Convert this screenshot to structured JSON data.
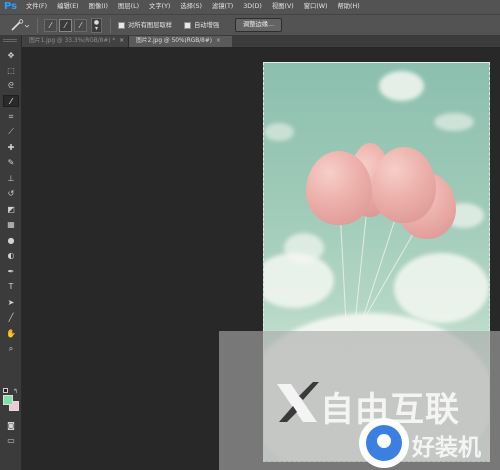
{
  "app": {
    "logo": "Ps"
  },
  "menu": [
    "文件(F)",
    "编辑(E)",
    "图像(I)",
    "图层(L)",
    "文字(Y)",
    "选择(S)",
    "滤镜(T)",
    "3D(D)",
    "视图(V)",
    "窗口(W)",
    "帮助(H)"
  ],
  "options": {
    "sample_all_layers": "对所有图层取样",
    "auto_enhance": "自动增强",
    "refine_edge": "调整边缘..."
  },
  "tabs": [
    {
      "label": "图片1.jpg @ 33.3%(RGB/8#) *",
      "close": "×"
    },
    {
      "label": "图片2.jpg @ 50%(RGB/8#)",
      "close": "×"
    }
  ],
  "colors": {
    "foreground": "#7fe0a6",
    "background": "#f0c8d2",
    "ps_blue": "#2ba0ff"
  },
  "watermarks": {
    "first": "自由互联",
    "second": "好装机"
  },
  "toolbar_icons": [
    "move-icon",
    "marquee-icon",
    "lasso-icon",
    "quick-selection-icon",
    "crop-icon",
    "eyedropper-icon",
    "spot-healing-icon",
    "brush-icon",
    "clone-stamp-icon",
    "history-brush-icon",
    "eraser-icon",
    "gradient-icon",
    "blur-icon",
    "dodge-icon",
    "pen-icon",
    "type-icon",
    "path-selection-icon",
    "line-icon",
    "hand-icon",
    "zoom-icon"
  ]
}
